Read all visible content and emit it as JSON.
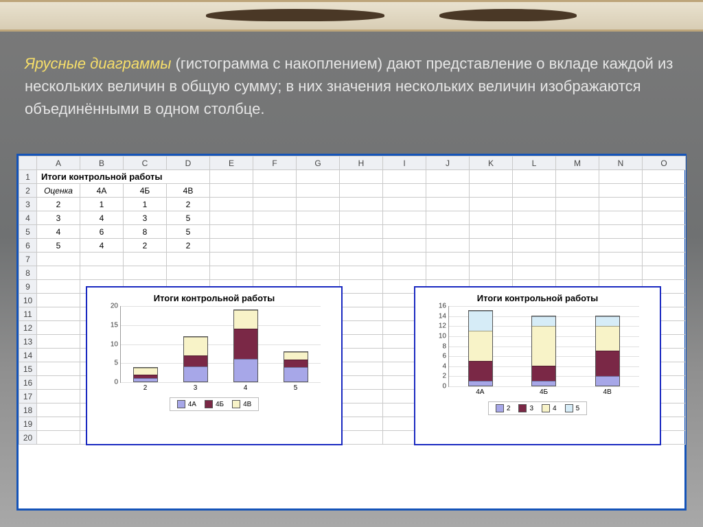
{
  "headline": {
    "lead": "Ярусные диаграммы",
    "rest": " (гистограмма с накоплением) дают представление о вкладе каждой из нескольких величин в общую сумму; в них значения нескольких величин изображаются объединёнными в одном столбце."
  },
  "spreadsheet": {
    "columns": [
      "A",
      "B",
      "C",
      "D",
      "E",
      "F",
      "G",
      "H",
      "I",
      "J",
      "K",
      "L",
      "M",
      "N",
      "O"
    ],
    "row_numbers": [
      "1",
      "2",
      "3",
      "4",
      "5",
      "6",
      "7",
      "8",
      "9",
      "10",
      "11",
      "12",
      "13",
      "14",
      "15",
      "16",
      "17",
      "18",
      "19",
      "20"
    ],
    "title_row": "Итоги контрольной работы",
    "header_row": [
      "Оценка",
      "4А",
      "4Б",
      "4В"
    ],
    "data_rows": [
      [
        "2",
        "1",
        "1",
        "2"
      ],
      [
        "3",
        "4",
        "3",
        "5"
      ],
      [
        "4",
        "6",
        "8",
        "5"
      ],
      [
        "5",
        "4",
        "2",
        "2"
      ]
    ]
  },
  "chart_data": [
    {
      "type": "bar",
      "stacked": true,
      "title": "Итоги контрольной работы",
      "categories": [
        "2",
        "3",
        "4",
        "5"
      ],
      "series": [
        {
          "name": "4А",
          "values": [
            1,
            4,
            6,
            4
          ],
          "color": "#a7a7e8"
        },
        {
          "name": "4Б",
          "values": [
            1,
            3,
            8,
            2
          ],
          "color": "#7a2846"
        },
        {
          "name": "4В",
          "values": [
            2,
            5,
            5,
            2
          ],
          "color": "#f8f3c8"
        }
      ],
      "ylim": [
        0,
        20
      ],
      "yticks": [
        0,
        5,
        10,
        15,
        20
      ],
      "xlabel": "",
      "ylabel": ""
    },
    {
      "type": "bar",
      "stacked": true,
      "title": "Итоги контрольной работы",
      "categories": [
        "4А",
        "4Б",
        "4В"
      ],
      "series": [
        {
          "name": "2",
          "values": [
            1,
            1,
            2
          ],
          "color": "#a7a7e8"
        },
        {
          "name": "3",
          "values": [
            4,
            3,
            5
          ],
          "color": "#7a2846"
        },
        {
          "name": "4",
          "values": [
            6,
            8,
            5
          ],
          "color": "#f8f3c8"
        },
        {
          "name": "5",
          "values": [
            4,
            2,
            2
          ],
          "color": "#d6ecf7"
        }
      ],
      "ylim": [
        0,
        16
      ],
      "yticks": [
        0,
        2,
        4,
        6,
        8,
        10,
        12,
        14,
        16
      ],
      "xlabel": "",
      "ylabel": ""
    }
  ]
}
